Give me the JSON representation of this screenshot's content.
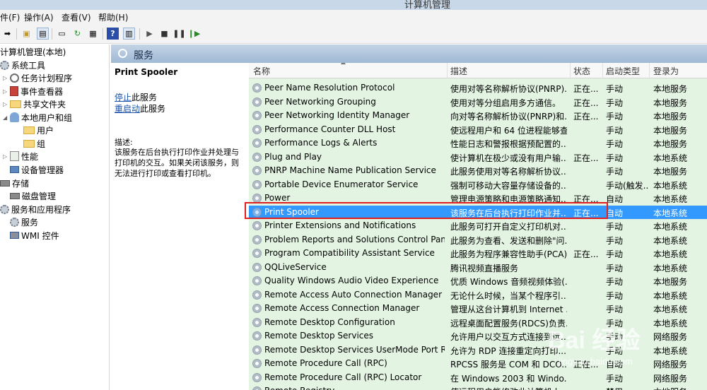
{
  "window": {
    "title": "计算机管理"
  },
  "menu": [
    "件(F)",
    "操作(A)",
    "查看(V)",
    "帮助(H)"
  ],
  "tree": {
    "items": [
      {
        "label": "计算机管理(本地)",
        "icon": "computer-icon",
        "arrow": ""
      },
      {
        "label": "系统工具",
        "icon": "tools-icon",
        "arrow": "▲"
      },
      {
        "label": "任务计划程序",
        "icon": "clock-icon",
        "arrow": "▷"
      },
      {
        "label": "事件查看器",
        "icon": "event-viewer-icon",
        "arrow": "▷"
      },
      {
        "label": "共享文件夹",
        "icon": "shared-folder-icon",
        "arrow": "▷"
      },
      {
        "label": "本地用户和组",
        "icon": "users-icon",
        "arrow": "◢"
      },
      {
        "label": "用户",
        "icon": "folder-icon",
        "arrow": ""
      },
      {
        "label": "组",
        "icon": "folder-icon",
        "arrow": ""
      },
      {
        "label": "性能",
        "icon": "performance-icon",
        "arrow": "▷"
      },
      {
        "label": "设备管理器",
        "icon": "device-manager-icon",
        "arrow": ""
      },
      {
        "label": "存储",
        "icon": "storage-icon",
        "arrow": ""
      },
      {
        "label": "磁盘管理",
        "icon": "disk-icon",
        "arrow": ""
      },
      {
        "label": "服务和应用程序",
        "icon": "apps-icon",
        "arrow": ""
      },
      {
        "label": "服务",
        "icon": "services-icon",
        "arrow": ""
      },
      {
        "label": "WMI 控件",
        "icon": "wmi-icon",
        "arrow": ""
      }
    ]
  },
  "panel": {
    "title": "服务"
  },
  "details": {
    "service_name": "Print Spooler",
    "stop_link": "停止",
    "stop_suffix": "此服务",
    "restart_link": "重启动",
    "restart_suffix": "此服务",
    "desc_label": "描述:",
    "desc_text": "该服务在后台执行打印作业并处理与打印机的交互。如果关闭该服务，则无法进行打印或查看打印机。"
  },
  "columns": {
    "name": "名称",
    "description": "描述",
    "status": "状态",
    "startup": "启动类型",
    "logon": "登录为"
  },
  "services": [
    {
      "name": "Peer Name Resolution Protocol",
      "desc": "使用对等名称解析协议(PNRP)...",
      "status": "正在...",
      "startup": "手动",
      "logon": "本地服务"
    },
    {
      "name": "Peer Networking Grouping",
      "desc": "使用对等分组启用多方通信。",
      "status": "正在...",
      "startup": "手动",
      "logon": "本地服务"
    },
    {
      "name": "Peer Networking Identity Manager",
      "desc": "向对等名称解析协议(PNRP)和...",
      "status": "正在...",
      "startup": "手动",
      "logon": "本地服务"
    },
    {
      "name": "Performance Counter DLL Host",
      "desc": "使远程用户和 64 位进程能够查...",
      "status": "",
      "startup": "手动",
      "logon": "本地服务"
    },
    {
      "name": "Performance Logs & Alerts",
      "desc": "性能日志和警报根据预配置的...",
      "status": "",
      "startup": "手动",
      "logon": "本地服务"
    },
    {
      "name": "Plug and Play",
      "desc": "使计算机在极少或没有用户输...",
      "status": "正在...",
      "startup": "手动",
      "logon": "本地系统"
    },
    {
      "name": "PNRP Machine Name Publication Service",
      "desc": "此服务使用对等名称解析协议...",
      "status": "",
      "startup": "手动",
      "logon": "本地服务"
    },
    {
      "name": "Portable Device Enumerator Service",
      "desc": "强制可移动大容量存储设备的...",
      "status": "",
      "startup": "手动(触发...",
      "logon": "本地系统"
    },
    {
      "name": "Power",
      "desc": "管理电源策略和电源策略通知...",
      "status": "正在...",
      "startup": "自动",
      "logon": "本地系统"
    },
    {
      "name": "Print Spooler",
      "desc": "该服务在后台执行打印作业并...",
      "status": "正在...",
      "startup": "自动",
      "logon": "本地系统"
    },
    {
      "name": "Printer Extensions and Notifications",
      "desc": "此服务可打开自定义打印机对...",
      "status": "",
      "startup": "手动",
      "logon": "本地系统"
    },
    {
      "name": "Problem Reports and Solutions Control Panel ...",
      "desc": "此服务为查看、发送和删除\"问...",
      "status": "",
      "startup": "手动",
      "logon": "本地系统"
    },
    {
      "name": "Program Compatibility Assistant Service",
      "desc": "此服务为程序兼容性助手(PCA)...",
      "status": "正在...",
      "startup": "手动",
      "logon": "本地系统"
    },
    {
      "name": "QQLiveService",
      "desc": "腾讯视频直播服务",
      "status": "",
      "startup": "手动",
      "logon": "本地系统"
    },
    {
      "name": "Quality Windows Audio Video Experience",
      "desc": "优质 Windows 音频视频体验(...",
      "status": "",
      "startup": "手动",
      "logon": "本地服务"
    },
    {
      "name": "Remote Access Auto Connection Manager",
      "desc": "无论什么时候，当某个程序引...",
      "status": "",
      "startup": "手动",
      "logon": "本地系统"
    },
    {
      "name": "Remote Access Connection Manager",
      "desc": "管理从这台计算机到 Internet ...",
      "status": "",
      "startup": "手动",
      "logon": "本地系统"
    },
    {
      "name": "Remote Desktop Configuration",
      "desc": "远程桌面配置服务(RDCS)负责...",
      "status": "",
      "startup": "手动",
      "logon": "本地系统"
    },
    {
      "name": "Remote Desktop Services",
      "desc": "允许用户以交互方式连接到远...",
      "status": "",
      "startup": "手动",
      "logon": "网络服务"
    },
    {
      "name": "Remote Desktop Services UserMode Port Re...",
      "desc": "允许为 RDP 连接重定向打印...",
      "status": "",
      "startup": "手动",
      "logon": "本地系统"
    },
    {
      "name": "Remote Procedure Call (RPC)",
      "desc": "RPCSS 服务是 COM 和 DCO...",
      "status": "正在...",
      "startup": "自动",
      "logon": "网络服务"
    },
    {
      "name": "Remote Procedure Call (RPC) Locator",
      "desc": "在 Windows 2003 和 Windo...",
      "status": "",
      "startup": "手动",
      "logon": "网络服务"
    },
    {
      "name": "Remote Registry",
      "desc": "使远程用户能修改此计算机上...",
      "status": "",
      "startup": "禁用",
      "logon": "本地服务"
    }
  ],
  "selected_service": "Print Spooler",
  "watermark": {
    "line1": "Bai 经验",
    "line2": "jingyan.baidu.com"
  },
  "colors": {
    "selection": "#3399ff",
    "highlight_box": "#e01f1f",
    "list_bg": "#e3f4e3"
  }
}
